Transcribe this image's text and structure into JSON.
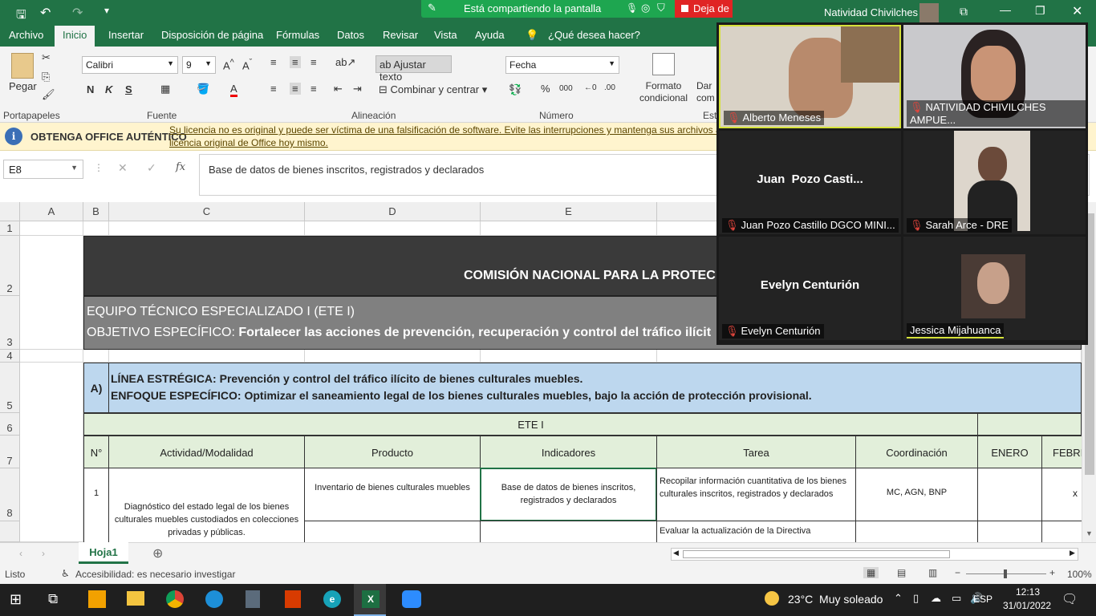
{
  "titlebar": {
    "share_status": "Está compartiendo la pantalla",
    "stop_share": "Deja de",
    "user": "Natividad Chivilches"
  },
  "menu": {
    "tabs": [
      "Archivo",
      "Inicio",
      "Insertar",
      "Disposición de página",
      "Fórmulas",
      "Datos",
      "Revisar",
      "Vista",
      "Ayuda"
    ],
    "tell_me": "¿Qué desea hacer?"
  },
  "ribbon": {
    "paste": "Pegar",
    "font_name": "Calibri",
    "font_size": "9",
    "wrap_text": "Ajustar texto",
    "merge_center": "Combinar y centrar",
    "number_format": "Fecha",
    "cond_format": "Formato condicional",
    "cut_label": "Dar com",
    "groups": {
      "clipboard": "Portapapeles",
      "font": "Fuente",
      "alignment": "Alineación",
      "number": "Número",
      "styles": "Esti"
    },
    "bold": "N",
    "italic": "K",
    "underline": "S"
  },
  "license": {
    "title": "OBTENGA OFFICE AUTÉNTICO",
    "message_1": "Su licencia no es original y puede ser víctima de una falsificación de software. Evite las interrupciones y mantenga sus archivos a",
    "message_2": "licencia original de Office hoy mismo."
  },
  "formula": {
    "name_box": "E8",
    "fx": "fx",
    "content": "Base de datos de bienes inscritos, registrados y declarados"
  },
  "columns": [
    "A",
    "B",
    "C",
    "D",
    "E"
  ],
  "rows": [
    "1",
    "2",
    "3",
    "4",
    "5",
    "6",
    "7",
    "8"
  ],
  "sheet": {
    "title": "COMISIÓN NACIONAL PARA LA PROTEC",
    "team": "EQUIPO TÉCNICO ESPECIALIZADO I (ETE I)",
    "objective_label": "OBJETIVO ESPECÍFICO: ",
    "objective": "Fortalecer las acciones de prevención, recuperación y control del tráfico ilícit",
    "section": "A)",
    "line_label": "LÍNEA ESTRÉGICA: ",
    "line": "Prevención y control del tráfico ilícito de bienes culturales muebles.",
    "focus_label": "ENFOQUE ESPECÍFICO: ",
    "focus": "Optimizar el saneamiento legal de los bienes culturales muebles, bajo la acción de protección provisional.",
    "ete": "ETE I",
    "headers": [
      "N°",
      "Actividad/Modalidad",
      "Producto",
      "Indicadores",
      "Tarea",
      "Coordinación",
      "ENERO",
      "FEBRI"
    ],
    "row1": {
      "n": "1",
      "activity": "Diagnóstico del estado legal de los bienes culturales muebles custodiados en colecciones privadas y públicas.",
      "product": "Inventario de bienes culturales muebles",
      "indicator": "Base de datos de bienes inscritos, registrados y declarados",
      "task": "Recopilar información cuantitativa de los bienes culturales inscritos, registrados y declarados",
      "coord": "MC, AGN, BNP",
      "feb": "x"
    },
    "row2_task": "Evaluar la actualización de la Directiva"
  },
  "sheet_tab": "Hoja1",
  "status": {
    "ready": "Listo",
    "accessibility": "Accesibilidad: es necesario investigar",
    "zoom": "100%"
  },
  "zoom_participants": [
    {
      "name": "Alberto Meneses",
      "muted": true
    },
    {
      "name": "NATIVIDAD CHIVILCHES AMPUE...",
      "muted": true
    },
    {
      "display": "Juan  Pozo Casti...",
      "name": "Juan  Pozo Castillo DGCO MINI...",
      "muted": true
    },
    {
      "name": "Sarah Arce - DRE",
      "muted": true
    },
    {
      "display": "Evelyn Centurión",
      "name": "Evelyn Centurión",
      "muted": true
    },
    {
      "name": "Jessica Mijahuanca",
      "muted": false
    }
  ],
  "taskbar": {
    "weather": "23°C  Muy soleado",
    "lang": "ESP",
    "time": "12:13",
    "date": "31/01/2022"
  },
  "colors": {
    "excel_green": "#217346",
    "header_dark": "#3a3a3a",
    "header_gray": "#808080",
    "section_blue": "#bdd7ee",
    "ete_green": "#e2efda"
  }
}
